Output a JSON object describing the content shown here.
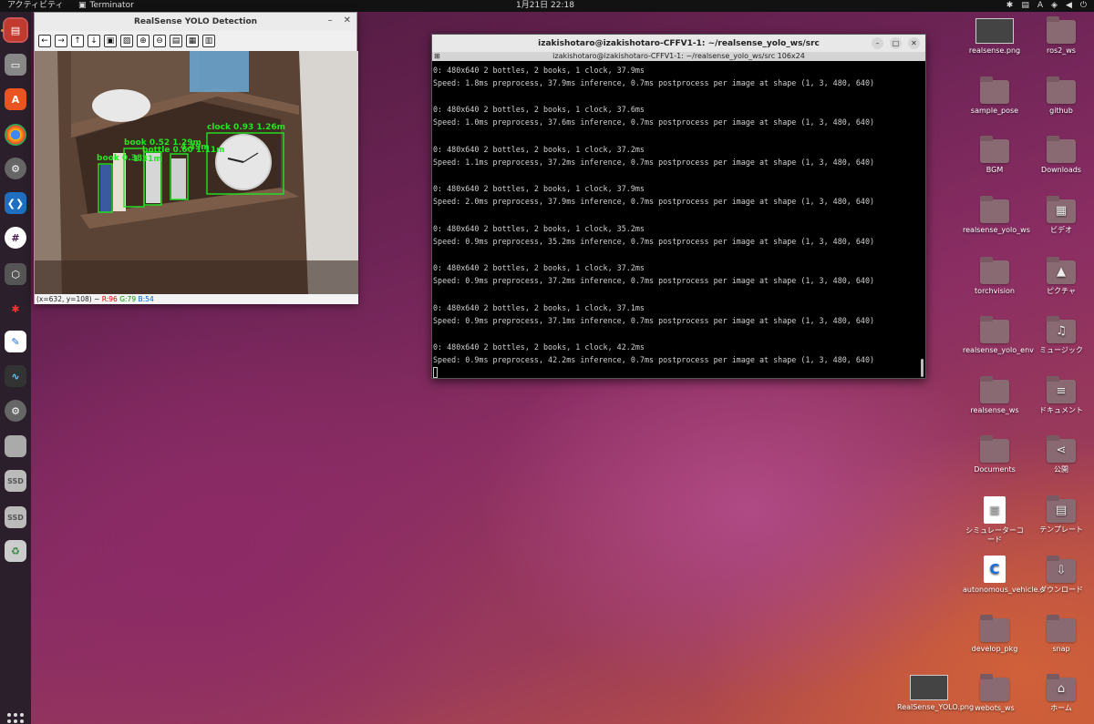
{
  "topbar": {
    "activities": "アクティビティ",
    "app_name": "Terminator",
    "clock": "1月21日 22:18",
    "input_method": "A"
  },
  "yolo_window": {
    "title": "RealSense YOLO Detection",
    "status_coords": "(x=632, y=108) ~",
    "status_r": "R:96",
    "status_g": "G:79",
    "status_b": "B:54",
    "detections": [
      {
        "label": "clock 0.93 1.26m"
      },
      {
        "label": "book 0.52 1.29m"
      },
      {
        "label": "bottle 0.60 1.11m"
      },
      {
        "label": "book 0.38"
      },
      {
        "label": "1.31m"
      },
      {
        "label": "4.49m"
      }
    ]
  },
  "terminal": {
    "title": "izakishotaro@izakishotaro-CFFV1-1: ~/realsense_yolo_ws/src",
    "subtitle": "izakishotaro@izakishotaro-CFFV1-1: ~/realsense_yolo_ws/src 106x24",
    "lines": [
      "0: 480x640 2 bottles, 2 books, 1 clock, 37.9ms",
      "Speed: 1.8ms preprocess, 37.9ms inference, 0.7ms postprocess per image at shape (1, 3, 480, 640)",
      "",
      "0: 480x640 2 bottles, 2 books, 1 clock, 37.6ms",
      "Speed: 1.0ms preprocess, 37.6ms inference, 0.7ms postprocess per image at shape (1, 3, 480, 640)",
      "",
      "0: 480x640 2 bottles, 2 books, 1 clock, 37.2ms",
      "Speed: 1.1ms preprocess, 37.2ms inference, 0.7ms postprocess per image at shape (1, 3, 480, 640)",
      "",
      "0: 480x640 2 bottles, 2 books, 1 clock, 37.9ms",
      "Speed: 2.0ms preprocess, 37.9ms inference, 0.7ms postprocess per image at shape (1, 3, 480, 640)",
      "",
      "0: 480x640 2 bottles, 2 books, 1 clock, 35.2ms",
      "Speed: 0.9ms preprocess, 35.2ms inference, 0.7ms postprocess per image at shape (1, 3, 480, 640)",
      "",
      "0: 480x640 2 bottles, 2 books, 1 clock, 37.2ms",
      "Speed: 0.9ms preprocess, 37.2ms inference, 0.7ms postprocess per image at shape (1, 3, 480, 640)",
      "",
      "0: 480x640 2 bottles, 2 books, 1 clock, 37.1ms",
      "Speed: 0.9ms preprocess, 37.1ms inference, 0.7ms postprocess per image at shape (1, 3, 480, 640)",
      "",
      "0: 480x640 2 bottles, 2 books, 1 clock, 42.2ms",
      "Speed: 0.9ms preprocess, 42.2ms inference, 0.7ms postprocess per image at shape (1, 3, 480, 640)"
    ]
  },
  "desktop": {
    "col1": [
      "realsense.png",
      "sample_pose",
      "BGM",
      "realsense_yolo_ws",
      "torchvision",
      "realsense_yolo_env",
      "realsense_ws",
      "Documents",
      "シミュレーターコード",
      "autonomous_vehicle.c",
      "develop_pkg",
      "webots_ws"
    ],
    "col2": [
      "ros2_ws",
      "github",
      "Downloads",
      "ビデオ",
      "ピクチャ",
      "ミュージック",
      "ドキュメント",
      "公開",
      "テンプレート",
      "ダウンロード",
      "snap",
      "ホーム"
    ],
    "extra": [
      "RealSense_YOLO.png"
    ]
  },
  "colors": {
    "detection_box": "#22e622",
    "dock_bg": "#2a1f2a",
    "terminal_bg": "#000000"
  }
}
